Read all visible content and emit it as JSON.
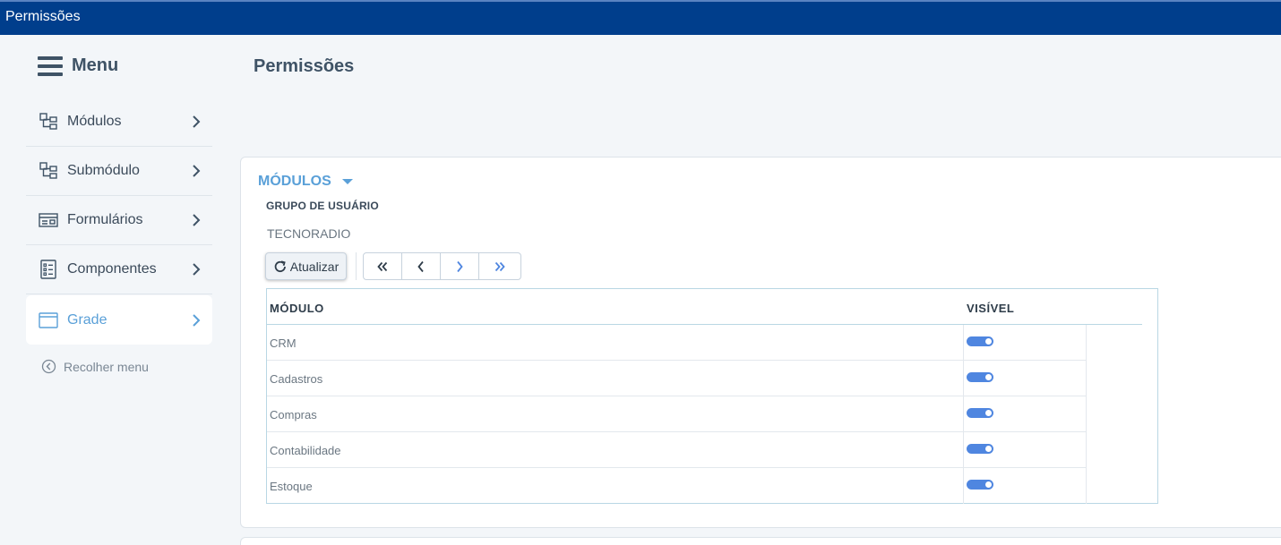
{
  "window": {
    "title": "Permissões"
  },
  "sidebar": {
    "menu_label": "Menu",
    "items": [
      {
        "label": "Módulos",
        "icon": "tree-icon",
        "active": false
      },
      {
        "label": "Submódulo",
        "icon": "tree-icon",
        "active": false
      },
      {
        "label": "Formulários",
        "icon": "form-icon",
        "active": false
      },
      {
        "label": "Componentes",
        "icon": "list-icon",
        "active": false
      },
      {
        "label": "Grade",
        "icon": "window-icon",
        "active": true
      }
    ],
    "collapse_label": "Recolher menu"
  },
  "main": {
    "page_title": "Permissões",
    "section_title": "MÓDULOS",
    "group_label": "GRUPO DE USUÁRIO",
    "group_value": "TECNORADIO",
    "toolbar": {
      "refresh_label": "Atualizar",
      "first_icon": "double-chevron-left-icon",
      "prev_icon": "chevron-left-icon",
      "next_icon": "chevron-right-icon",
      "last_icon": "double-chevron-right-icon"
    },
    "grid": {
      "columns": [
        "MÓDULO",
        "VISÍVEL"
      ],
      "rows": [
        {
          "modulo": "CRM",
          "visivel": true
        },
        {
          "modulo": "Cadastros",
          "visivel": true
        },
        {
          "modulo": "Compras",
          "visivel": true
        },
        {
          "modulo": "Contabilidade",
          "visivel": true
        },
        {
          "modulo": "Estoque",
          "visivel": true
        }
      ]
    }
  },
  "colors": {
    "titlebar": "#003e8c",
    "accent": "#5aa0d8",
    "toggle_on": "#4f86e0",
    "background": "#f3f6f9"
  }
}
